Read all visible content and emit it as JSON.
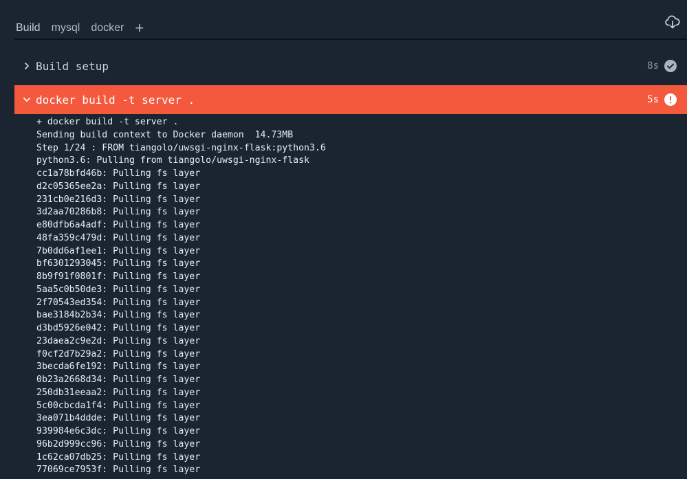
{
  "tabs": [
    {
      "label": "Build"
    },
    {
      "label": "mysql"
    },
    {
      "label": "docker"
    }
  ],
  "add_tab_label": "+",
  "icons": {
    "cloud": "cloud-download-icon",
    "chevron_right": "chevron-right-icon",
    "chevron_down": "chevron-down-icon",
    "success": "check-circle-icon",
    "error": "exclamation-circle-icon"
  },
  "colors": {
    "background": "#1b2531",
    "error_step": "#f5593d",
    "success_badge": "#a9b4c0"
  },
  "steps": [
    {
      "label": "Build setup",
      "duration": "8s",
      "status": "success",
      "expanded": false
    },
    {
      "label": "docker build -t server .",
      "duration": "5s",
      "status": "error",
      "expanded": true
    }
  ],
  "log_lines": [
    "+ docker build -t server .",
    "Sending build context to Docker daemon  14.73MB",
    "Step 1/24 : FROM tiangolo/uwsgi-nginx-flask:python3.6",
    "python3.6: Pulling from tiangolo/uwsgi-nginx-flask",
    "cc1a78bfd46b: Pulling fs layer",
    "d2c05365ee2a: Pulling fs layer",
    "231cb0e216d3: Pulling fs layer",
    "3d2aa70286b8: Pulling fs layer",
    "e80dfb6a4adf: Pulling fs layer",
    "48fa359c479d: Pulling fs layer",
    "7b0dd6af1ee1: Pulling fs layer",
    "bf6301293045: Pulling fs layer",
    "8b9f91f0801f: Pulling fs layer",
    "5aa5c0b50de3: Pulling fs layer",
    "2f70543ed354: Pulling fs layer",
    "bae3184b2b34: Pulling fs layer",
    "d3bd5926e042: Pulling fs layer",
    "23daea2c9e2d: Pulling fs layer",
    "f0cf2d7b29a2: Pulling fs layer",
    "3becda6fe192: Pulling fs layer",
    "0b23a2668d34: Pulling fs layer",
    "250db31eeaa2: Pulling fs layer",
    "5c00cbcda1f4: Pulling fs layer",
    "3ea071b4ddde: Pulling fs layer",
    "939984e6c3dc: Pulling fs layer",
    "96b2d999cc96: Pulling fs layer",
    "1c62ca07db25: Pulling fs layer",
    "77069ce7953f: Pulling fs layer"
  ]
}
